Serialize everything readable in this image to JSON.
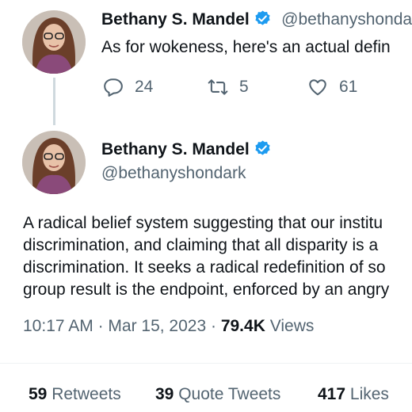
{
  "reply_tweet": {
    "name": "Bethany S. Mandel",
    "handle": "@bethanyshondark",
    "text": "As for wokeness, here's an actual defin",
    "actions": {
      "replies": "24",
      "retweets": "5",
      "likes": "61"
    }
  },
  "main_tweet": {
    "name": "Bethany S. Mandel",
    "handle": "@bethanyshondark",
    "body_lines": [
      "A radical belief system suggesting that our institu",
      "discrimination, and claiming that all disparity is a",
      "discrimination. It seeks a radical redefinition of so",
      "group result is the endpoint, enforced by an angry"
    ],
    "time": "10:17 AM",
    "date": "Mar 15, 2023",
    "views_count": "79.4K",
    "views_label": "Views"
  },
  "stats": {
    "retweets_count": "59",
    "retweets_label": "Retweets",
    "quotes_count": "39",
    "quotes_label": "Quote Tweets",
    "likes_count": "417",
    "likes_label": "Likes"
  },
  "colors": {
    "verified": "#1d9bf0",
    "secondary_text": "#536471"
  }
}
